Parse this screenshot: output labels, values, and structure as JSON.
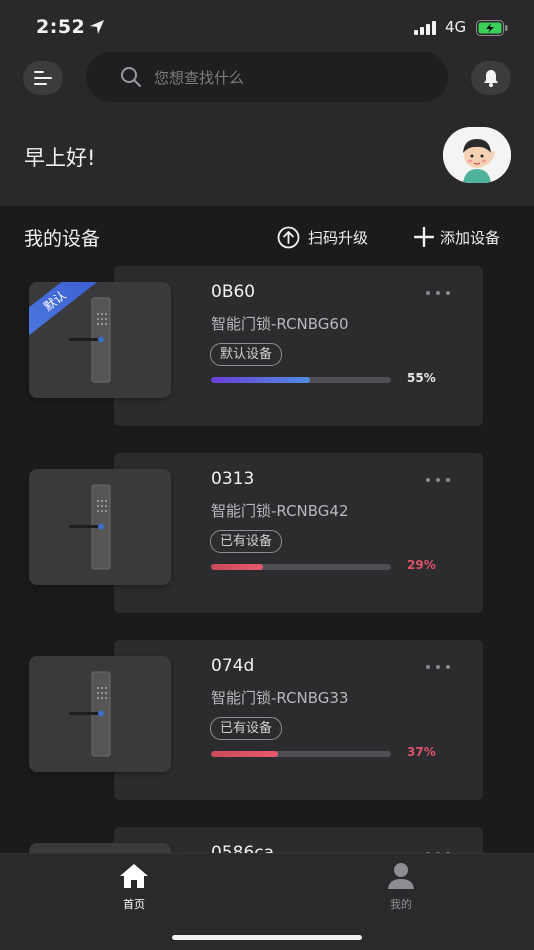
{
  "status_bar": {
    "time": "2:52",
    "network": "4G"
  },
  "search": {
    "placeholder": "您想查找什么"
  },
  "greeting": "早上好!",
  "section": {
    "title": "我的设备",
    "scan_label": "扫码升级",
    "add_label": "添加设备"
  },
  "devices": [
    {
      "name": "0B60",
      "model": "智能门锁-RCNBG60",
      "tag": "默认设备",
      "progress": 55,
      "progress_label": "55%",
      "is_default": true,
      "default_ribbon": "默认",
      "color": "#5a6fd6"
    },
    {
      "name": "0313",
      "model": "智能门锁-RCNBG42",
      "tag": "已有设备",
      "progress": 29,
      "progress_label": "29%",
      "is_default": false,
      "color": "#e0536a"
    },
    {
      "name": "074d",
      "model": "智能门锁-RCNBG33",
      "tag": "已有设备",
      "progress": 37,
      "progress_label": "37%",
      "is_default": false,
      "color": "#e0536a"
    },
    {
      "name": "0586ca",
      "model": "",
      "tag": "",
      "progress": null,
      "progress_label": "",
      "is_default": false
    }
  ],
  "tabs": [
    {
      "label": "首页",
      "icon": "home-icon",
      "active": true
    },
    {
      "label": "我的",
      "icon": "user-icon",
      "active": false
    }
  ],
  "colors": {
    "background": "#1b1b1d",
    "header": "#29292b",
    "card": "#2c2c2e",
    "default_gradient_start": "#6a3fd8",
    "default_gradient_end": "#4f8ce0",
    "warn_gradient_start": "#c84a5a",
    "warn_gradient_end": "#e85a6e"
  }
}
